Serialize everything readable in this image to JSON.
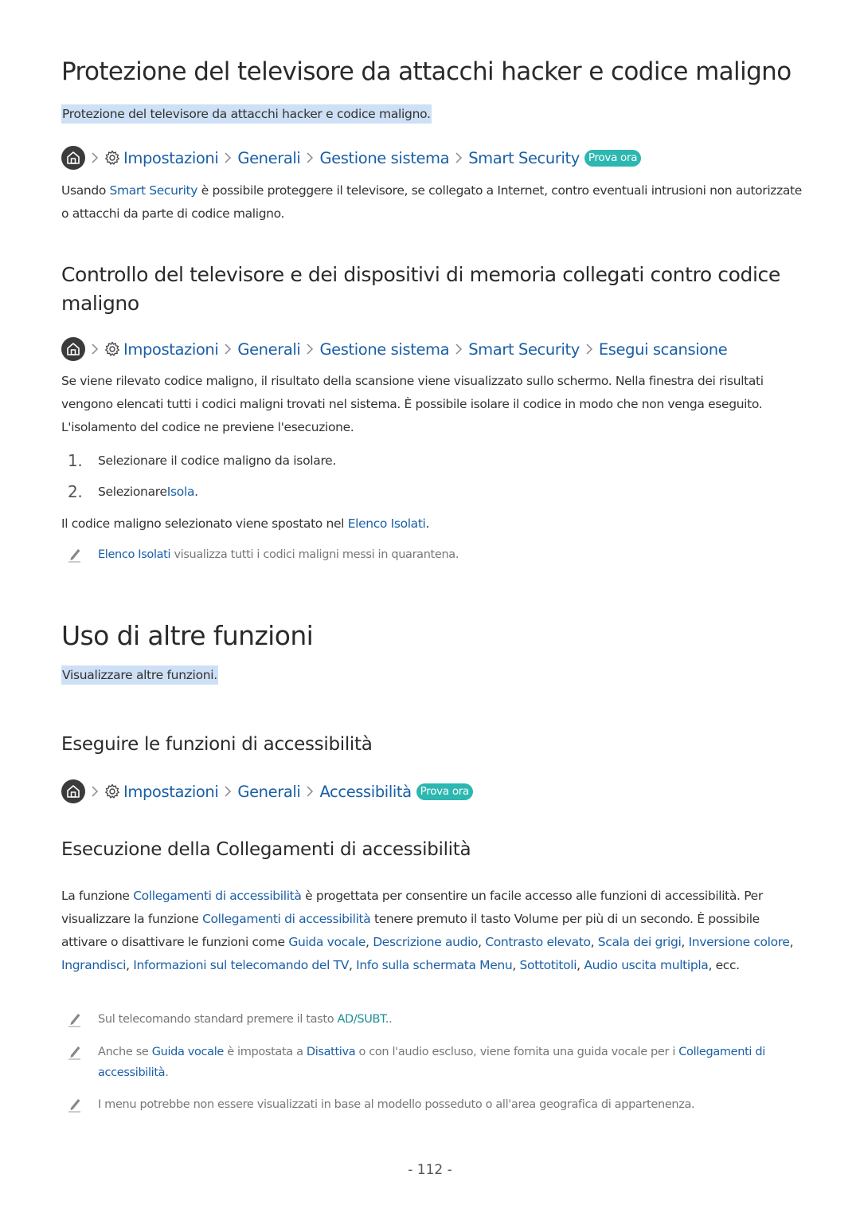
{
  "section1": {
    "title": "Protezione del televisore da attacchi hacker e codice maligno",
    "summary": "Protezione del televisore da attacchi hacker e codice maligno.",
    "breadcrumb": {
      "items": [
        "Impostazioni",
        "Generali",
        "Gestione sistema",
        "Smart Security"
      ],
      "badge": "Prova ora"
    },
    "para": {
      "pre": "Usando ",
      "link": "Smart Security",
      "post": " è possibile proteggere il televisore, se collegato a Internet, contro eventuali intrusioni non autorizzate o attacchi da parte di codice maligno."
    }
  },
  "section2": {
    "title": "Controllo del televisore e dei dispositivi di memoria collegati contro codice maligno",
    "breadcrumb": {
      "items": [
        "Impostazioni",
        "Generali",
        "Gestione sistema",
        "Smart Security",
        "Esegui scansione"
      ]
    },
    "para": "Se viene rilevato codice maligno, il risultato della scansione viene visualizzato sullo schermo. Nella finestra dei risultati vengono elencati tutti i codici maligni trovati nel sistema. È possibile isolare il codice in modo che non venga eseguito. L'isolamento del codice ne previene l'esecuzione.",
    "steps": [
      {
        "num": "1.",
        "text": "Selezionare il codice maligno da isolare.",
        "link": "",
        "post": ""
      },
      {
        "num": "2.",
        "text": "Selezionare ",
        "link": "Isola",
        "post": "."
      }
    ],
    "result": {
      "pre": "Il codice maligno selezionato viene spostato nel ",
      "link": "Elenco Isolati",
      "post": "."
    },
    "note": {
      "link": "Elenco Isolati",
      "post": " visualizza tutti i codici maligni messi in quarantena."
    }
  },
  "section3": {
    "title": "Uso di altre funzioni",
    "summary": "Visualizzare altre funzioni."
  },
  "section4": {
    "title": "Eseguire le funzioni di accessibilità",
    "breadcrumb": {
      "items": [
        "Impostazioni",
        "Generali",
        "Accessibilità"
      ],
      "badge": "Prova ora"
    }
  },
  "section5": {
    "title": "Esecuzione della Collegamenti di accessibilità",
    "para": {
      "t1": "La funzione ",
      "l1": "Collegamenti di accessibilità",
      "t2": " è progettata per consentire un facile accesso alle funzioni di accessibilità. Per visualizzare la funzione ",
      "l2": "Collegamenti di accessibilità",
      "t3": " tenere premuto il tasto Volume per più di un secondo. È possibile attivare o disattivare le funzioni come ",
      "features": [
        "Guida vocale",
        "Descrizione audio",
        "Contrasto elevato",
        "Scala dei grigi",
        "Inversione colore",
        "Ingrandisci",
        "Informazioni sul telecomando del TV",
        "Info sulla schermata Menu",
        "Sottotitoli",
        "Audio uscita multipla"
      ],
      "sep": ", ",
      "end": ", ecc."
    },
    "notes": [
      {
        "pre": "Sul telecomando standard premere il tasto ",
        "link": "AD/SUBT.",
        "post": "."
      },
      {
        "pre": "Anche se ",
        "l1": "Guida vocale",
        "mid1": " è impostata a ",
        "l2": "Disattiva",
        "mid2": " o con l'audio escluso, viene fornita una guida vocale per i ",
        "l3": "Collegamenti di accessibilità",
        "post": "."
      },
      {
        "text": "I menu potrebbe non essere visualizzati in base al modello posseduto o all'area geografica di appartenenza."
      }
    ]
  },
  "footer": {
    "page_number": "- 112 -"
  },
  "colors": {
    "link": "#1a5fa6",
    "badge": "#2cb7b1",
    "highlight": "#cde0f5",
    "teal_key": "#1b8f96"
  }
}
